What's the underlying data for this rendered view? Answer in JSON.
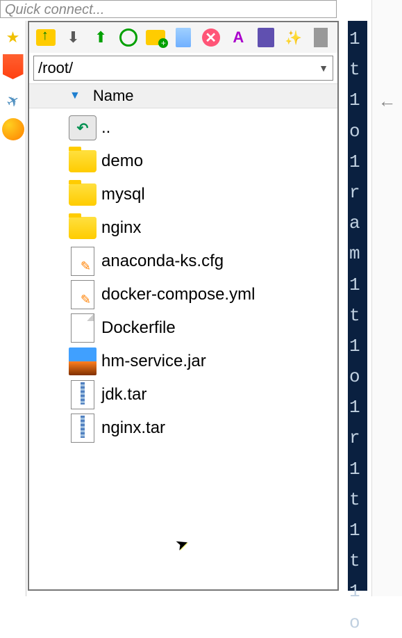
{
  "quick_connect_placeholder": "Quick connect...",
  "path": "/root/",
  "name_header": "Name",
  "right_strip_text": "1 t 1 o 1 r a m 1 t 1 o 1 r 1 t 1 t 1 o",
  "files": {
    "parent": "..",
    "f0": "demo",
    "f1": "mysql",
    "f2": "nginx",
    "f3": "anaconda-ks.cfg",
    "f4": "docker-compose.yml",
    "f5": "Dockerfile",
    "f6": "hm-service.jar",
    "f7": "jdk.tar",
    "f8": "nginx.tar"
  }
}
